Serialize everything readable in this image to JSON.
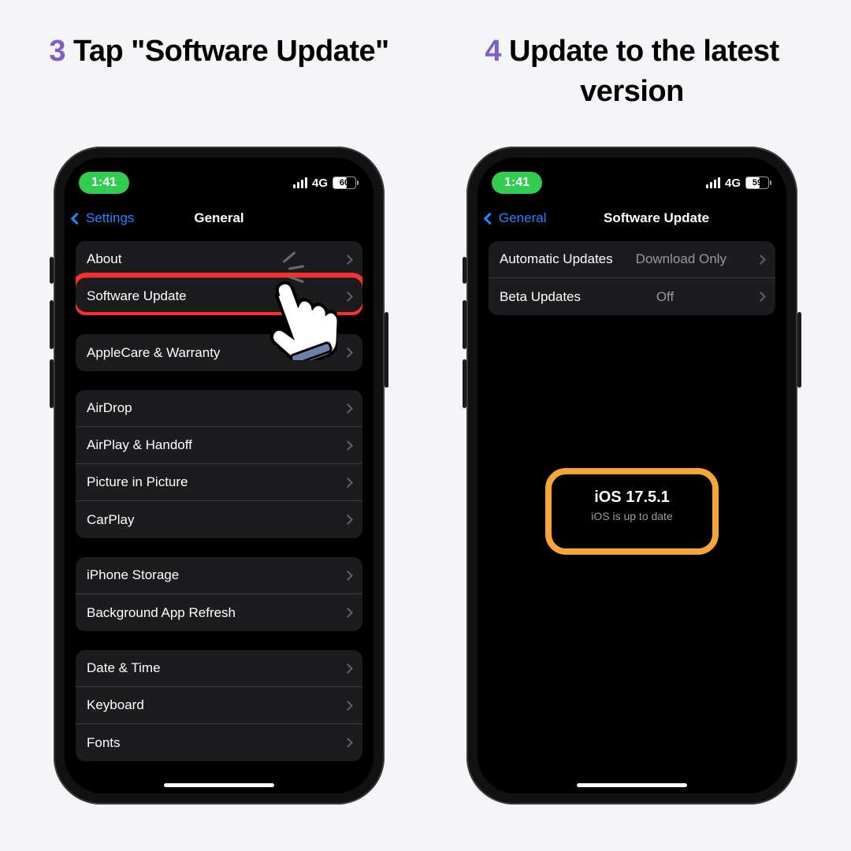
{
  "step3": {
    "num": "3",
    "text": "Tap \"Software Update\""
  },
  "step4": {
    "num": "4",
    "text": "Update to the latest version"
  },
  "phone_left": {
    "time": "1:41",
    "network": "4G",
    "battery": "60",
    "back_label": "Settings",
    "title": "General",
    "groups": [
      {
        "rows": [
          "About",
          "Software Update"
        ]
      },
      {
        "rows": [
          "AppleCare & Warranty"
        ]
      },
      {
        "rows": [
          "AirDrop",
          "AirPlay & Handoff",
          "Picture in Picture",
          "CarPlay"
        ]
      },
      {
        "rows": [
          "iPhone Storage",
          "Background App Refresh"
        ]
      },
      {
        "rows": [
          "Date & Time",
          "Keyboard",
          "Fonts"
        ]
      }
    ]
  },
  "phone_right": {
    "time": "1:41",
    "network": "4G",
    "battery": "59",
    "back_label": "General",
    "title": "Software Update",
    "rows": [
      {
        "label": "Automatic Updates",
        "detail": "Download Only"
      },
      {
        "label": "Beta Updates",
        "detail": "Off"
      }
    ],
    "version": "iOS 17.5.1",
    "status": "iOS is up to date"
  }
}
